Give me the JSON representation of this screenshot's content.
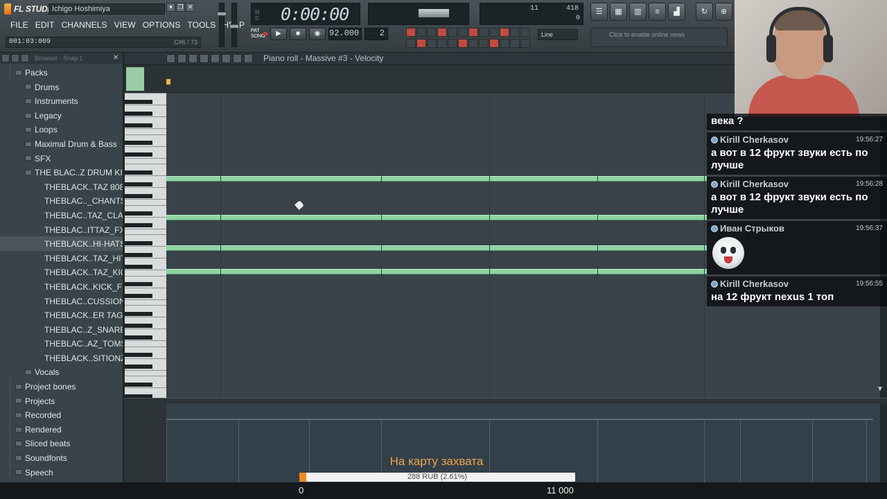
{
  "app": {
    "logo": "FL STUDIO",
    "project_title": "Ichigo Hoshimiya",
    "menu": [
      "FILE",
      "EDIT",
      "CHANNELS",
      "VIEW",
      "OPTIONS",
      "TOOLS",
      "HELP"
    ],
    "hint_time": "001:03:009",
    "hint_right": "C#6 / 73",
    "time_display": "0:00:00",
    "tempo": "92.000",
    "pattern": "2",
    "snap_mode": "Line",
    "news": "Click to enable online news",
    "cpu_values": [
      "11",
      "418",
      "0"
    ]
  },
  "browser": {
    "header_label": "Browser - Snap 1",
    "items": [
      {
        "label": "Packs",
        "level": 1
      },
      {
        "label": "Drums",
        "level": 2
      },
      {
        "label": "Instruments",
        "level": 2
      },
      {
        "label": "Legacy",
        "level": 2
      },
      {
        "label": "Loops",
        "level": 2
      },
      {
        "label": "Maximal Drum & Bass",
        "level": 2
      },
      {
        "label": "SFX",
        "level": 2
      },
      {
        "label": "THE BLAC..Z DRUM KIT",
        "level": 2
      },
      {
        "label": "THEBLACK..TAZ 808",
        "level": 3
      },
      {
        "label": "THEBLAC.._CHANTS",
        "level": 3
      },
      {
        "label": "THEBLAC..TAZ_CLAP",
        "level": 3
      },
      {
        "label": "THEBLAC..ITTAZ_FX",
        "level": 3
      },
      {
        "label": "THEBLACK..HI-HATS",
        "level": 3,
        "selected": true
      },
      {
        "label": "THEBLACK..TAZ_HITS",
        "level": 3
      },
      {
        "label": "THEBLACK..TAZ_KICK",
        "level": 3
      },
      {
        "label": "THEBLACK..KICK_FX",
        "level": 3
      },
      {
        "label": "THEBLAC..CUSSION",
        "level": 3
      },
      {
        "label": "THEBLACK..ER TAGS",
        "level": 3
      },
      {
        "label": "THEBLAC..Z_SNARES",
        "level": 3
      },
      {
        "label": "THEBLAC..AZ_TOMS",
        "level": 3
      },
      {
        "label": "THEBLACK..SITIONZ",
        "level": 3
      },
      {
        "label": "Vocals",
        "level": 2
      },
      {
        "label": "Project bones",
        "level": 1
      },
      {
        "label": "Projects",
        "level": 1
      },
      {
        "label": "Recorded",
        "level": 1
      },
      {
        "label": "Rendered",
        "level": 1
      },
      {
        "label": "Sliced beats",
        "level": 1
      },
      {
        "label": "Soundfonts",
        "level": 1
      },
      {
        "label": "Speech",
        "level": 1
      }
    ]
  },
  "piano_roll": {
    "title": "Piano roll - Massive #3 - Velocity",
    "note_count": 4
  },
  "chat": {
    "partial": "века ?",
    "messages": [
      {
        "user": "Kirill Cherkasov",
        "time": "19:56:27",
        "text": "а вот в 12 фрукт звуки есть по лучше"
      },
      {
        "user": "Kirill Cherkasov",
        "time": "19:56:28",
        "text": "а вот в 12 фрукт звуки есть по лучше"
      },
      {
        "user": "Иван Стрыков",
        "time": "19:56:37",
        "text": "",
        "sticker": "laughing-face-sticker"
      },
      {
        "user": "Kirill Cherkasov",
        "time": "19:56:55",
        "text": "на 12 фрукт nexus 1 топ"
      }
    ]
  },
  "donation": {
    "title": "На карту захвата",
    "progress_text": "288 RUB (2.61%)",
    "progress_fraction": 0.0261,
    "min_label": "0",
    "max_label": "11 000"
  },
  "colors": {
    "note": "#8fd3a2",
    "accent_orange": "#f08a24",
    "grid": "#394349"
  }
}
